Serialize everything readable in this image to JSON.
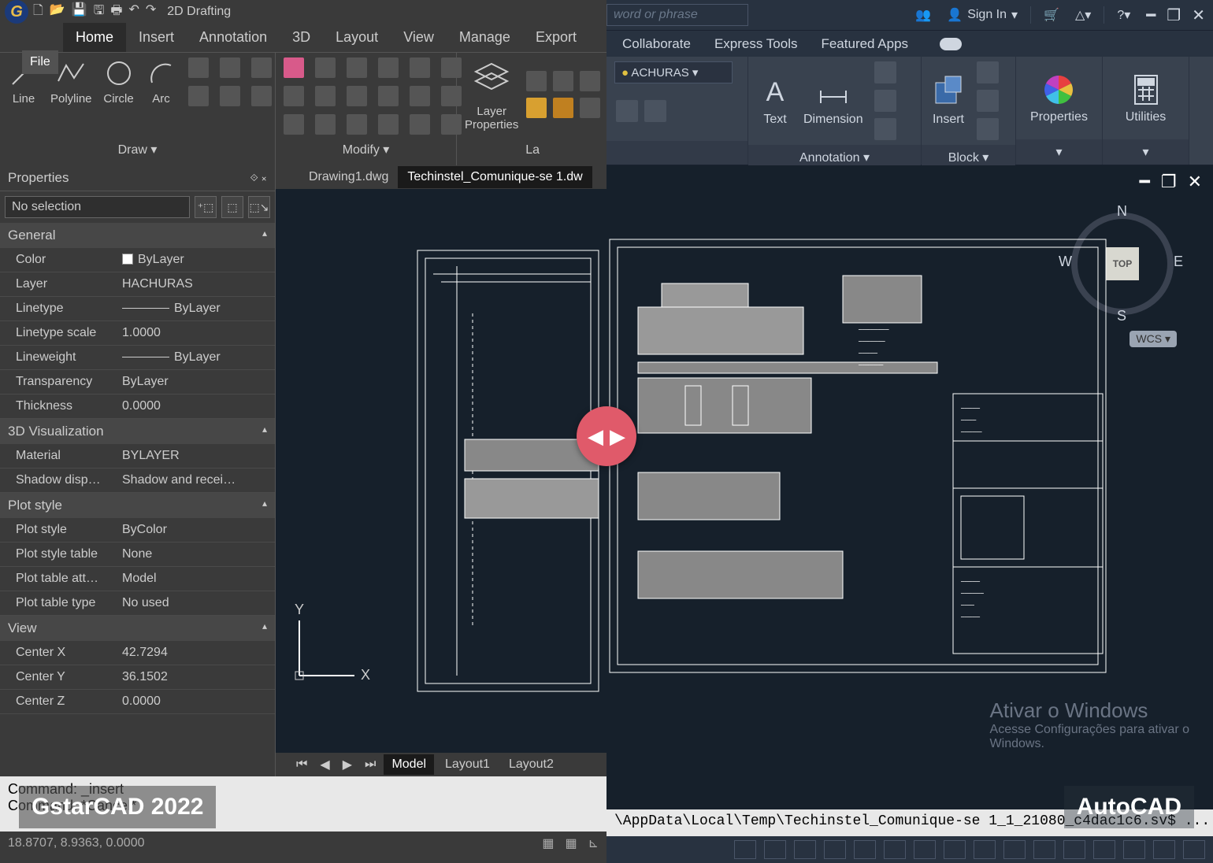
{
  "left": {
    "product_label": "GstarCAD 2022",
    "workspace": "2D Drafting",
    "file_btn": "File",
    "tabs": [
      "Home",
      "Insert",
      "Annotation",
      "3D",
      "Layout",
      "View",
      "Manage",
      "Export"
    ],
    "draw": {
      "title": "Draw  ▾",
      "tools": [
        {
          "name": "line",
          "label": "Line"
        },
        {
          "name": "polyline",
          "label": "Polyline"
        },
        {
          "name": "circle",
          "label": "Circle"
        },
        {
          "name": "arc",
          "label": "Arc"
        }
      ]
    },
    "modify": {
      "title": "Modify  ▾"
    },
    "layer": {
      "title": "La",
      "props": "Layer\nProperties"
    },
    "properties": {
      "title": "Properties",
      "selection": "No selection",
      "cats": [
        {
          "name": "General",
          "rows": [
            {
              "k": "Color",
              "v": "ByLayer",
              "swatch": true
            },
            {
              "k": "Layer",
              "v": "HACHURAS"
            },
            {
              "k": "Linetype",
              "v": "ByLayer",
              "line": true
            },
            {
              "k": "Linetype scale",
              "v": "1.0000"
            },
            {
              "k": "Lineweight",
              "v": "ByLayer",
              "line": true
            },
            {
              "k": "Transparency",
              "v": "ByLayer"
            },
            {
              "k": "Thickness",
              "v": "0.0000"
            }
          ]
        },
        {
          "name": "3D Visualization",
          "rows": [
            {
              "k": "Material",
              "v": "BYLAYER"
            },
            {
              "k": "Shadow disp…",
              "v": "Shadow and recei…"
            }
          ]
        },
        {
          "name": "Plot style",
          "rows": [
            {
              "k": "Plot style",
              "v": "ByColor"
            },
            {
              "k": "Plot style table",
              "v": "None"
            },
            {
              "k": "Plot table att…",
              "v": "Model"
            },
            {
              "k": "Plot table type",
              "v": "No used"
            }
          ]
        },
        {
          "name": "View",
          "rows": [
            {
              "k": "Center X",
              "v": "42.7294"
            },
            {
              "k": "Center Y",
              "v": "36.1502"
            },
            {
              "k": "Center Z",
              "v": "0.0000"
            }
          ]
        }
      ]
    },
    "doc_tabs": [
      "Drawing1.dwg",
      "Techinstel_Comunique-se 1.dw"
    ],
    "layout_tabs": [
      "Model",
      "Layout1",
      "Layout2"
    ],
    "command": {
      "l1": "Command: _insert",
      "l2": "Command: *Cancel*"
    },
    "status_coords": "18.8707, 8.9363, 0.0000",
    "ucs": {
      "x": "X",
      "y": "Y"
    }
  },
  "right": {
    "product_label": "AutoCAD",
    "search_ph": "word or phrase",
    "signin": "Sign In",
    "tabs": [
      "Collaborate",
      "Express Tools",
      "Featured Apps"
    ],
    "layer_dd": "ACHURAS",
    "annotation": {
      "title": "Annotation ▾",
      "text": "Text",
      "dim": "Dimension"
    },
    "block": {
      "title": "Block ▾",
      "insert": "Insert"
    },
    "props_panel": "Properties",
    "util_panel": "Utilities",
    "viewcube": {
      "top": "TOP",
      "n": "N",
      "s": "S",
      "e": "E",
      "w": "W",
      "wcs": "WCS ▾"
    },
    "cmd": "\\AppData\\Local\\Temp\\Techinstel_Comunique-se 1_1_21080_c4dac1c6.sv$ ...",
    "watermark": {
      "l1": "Ativar o Windows",
      "l2": "Acesse Configurações para ativar o",
      "l3": "Windows."
    }
  }
}
